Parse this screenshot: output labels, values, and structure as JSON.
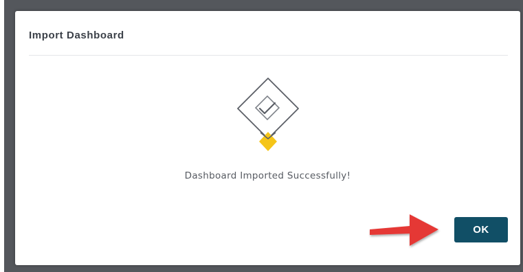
{
  "dialog": {
    "title": "Import Dashboard",
    "message": "Dashboard Imported Successfully!",
    "ok_label": "OK",
    "icon": "success-diamond-check-icon",
    "annotation_icon": "red-arrow-icon"
  },
  "colors": {
    "backdrop": "#54575c",
    "ok_button": "#114f66",
    "diamond_accent": "#f5c518",
    "arrow": "#e53935"
  }
}
